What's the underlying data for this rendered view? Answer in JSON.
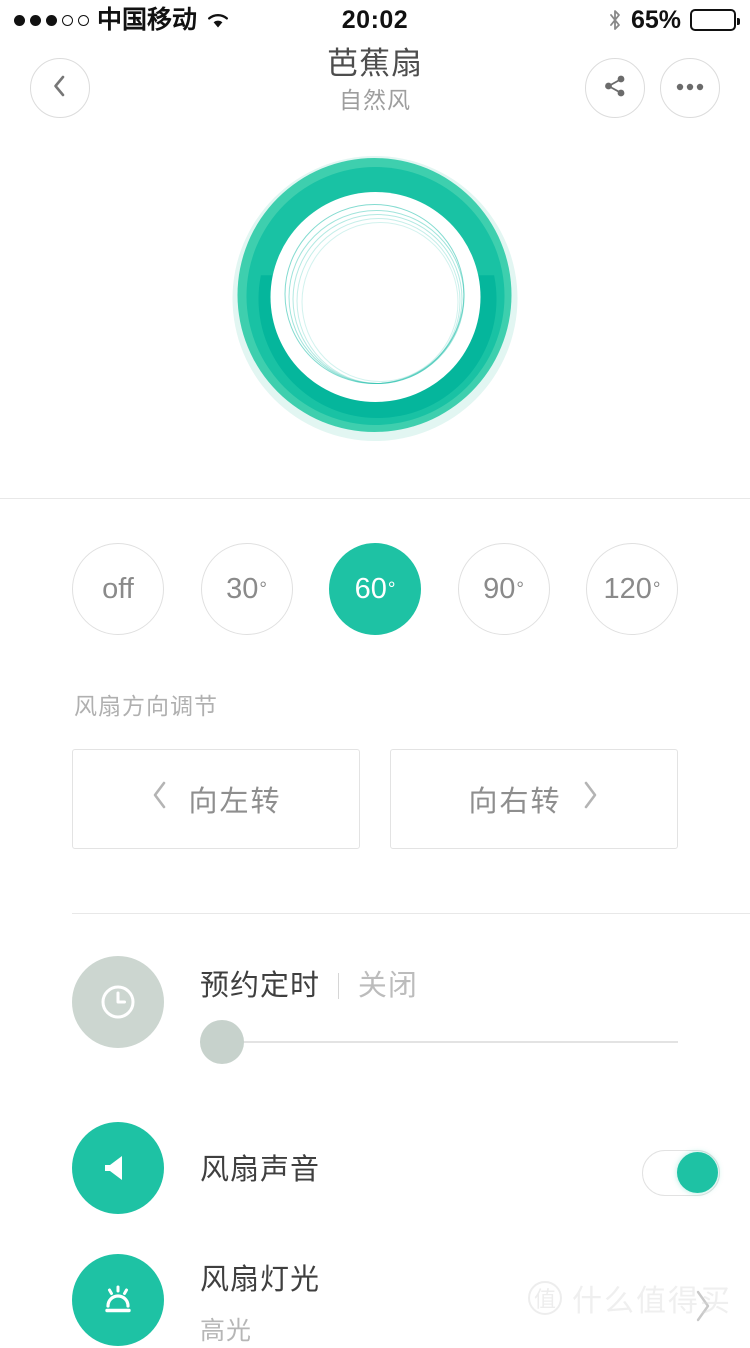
{
  "status_bar": {
    "signal_filled": 3,
    "signal_total": 5,
    "carrier": "中国移动",
    "wifi_icon": "wifi-icon",
    "time": "20:02",
    "bluetooth_icon": "bluetooth-icon",
    "battery_percent": "65%",
    "battery_level": 0.65
  },
  "nav": {
    "back_icon": "chevron-left-icon",
    "title": "芭蕉扇",
    "subtitle": "自然风",
    "share_icon": "share-icon",
    "more_icon": "more-dots-icon"
  },
  "fan": {
    "graphic_name": "fan-ring-animation",
    "ring_color": "#19c2a4",
    "ring_color_light": "#3ecfae",
    "ring_color_deep": "#05b69c",
    "halo_color": "#e2f6f2"
  },
  "angle_control": {
    "options": [
      {
        "label": "off",
        "selected": false
      },
      {
        "label": "30",
        "degree": "°",
        "selected": false
      },
      {
        "label": "60",
        "degree": "°",
        "selected": true
      },
      {
        "label": "90",
        "degree": "°",
        "selected": false
      },
      {
        "label": "120",
        "degree": "°",
        "selected": false
      }
    ],
    "accent_color": "#1ec2a4",
    "section_label": "风扇方向调节"
  },
  "rotate": {
    "left_label": "向左转",
    "left_icon": "chevron-left-icon",
    "right_label": "向右转",
    "right_icon": "chevron-right-icon"
  },
  "list": {
    "timer": {
      "icon": "clock-icon",
      "title": "预约定时",
      "value": "关闭",
      "slider_position": 0
    },
    "sound": {
      "icon": "speaker-icon",
      "title": "风扇声音",
      "toggle_on": true
    },
    "light": {
      "icon": "brightness-icon",
      "title": "风扇灯光",
      "value": "高光",
      "chevron_icon": "chevron-right-icon"
    }
  },
  "watermark": {
    "badge": "值",
    "text": "什么值得买"
  }
}
